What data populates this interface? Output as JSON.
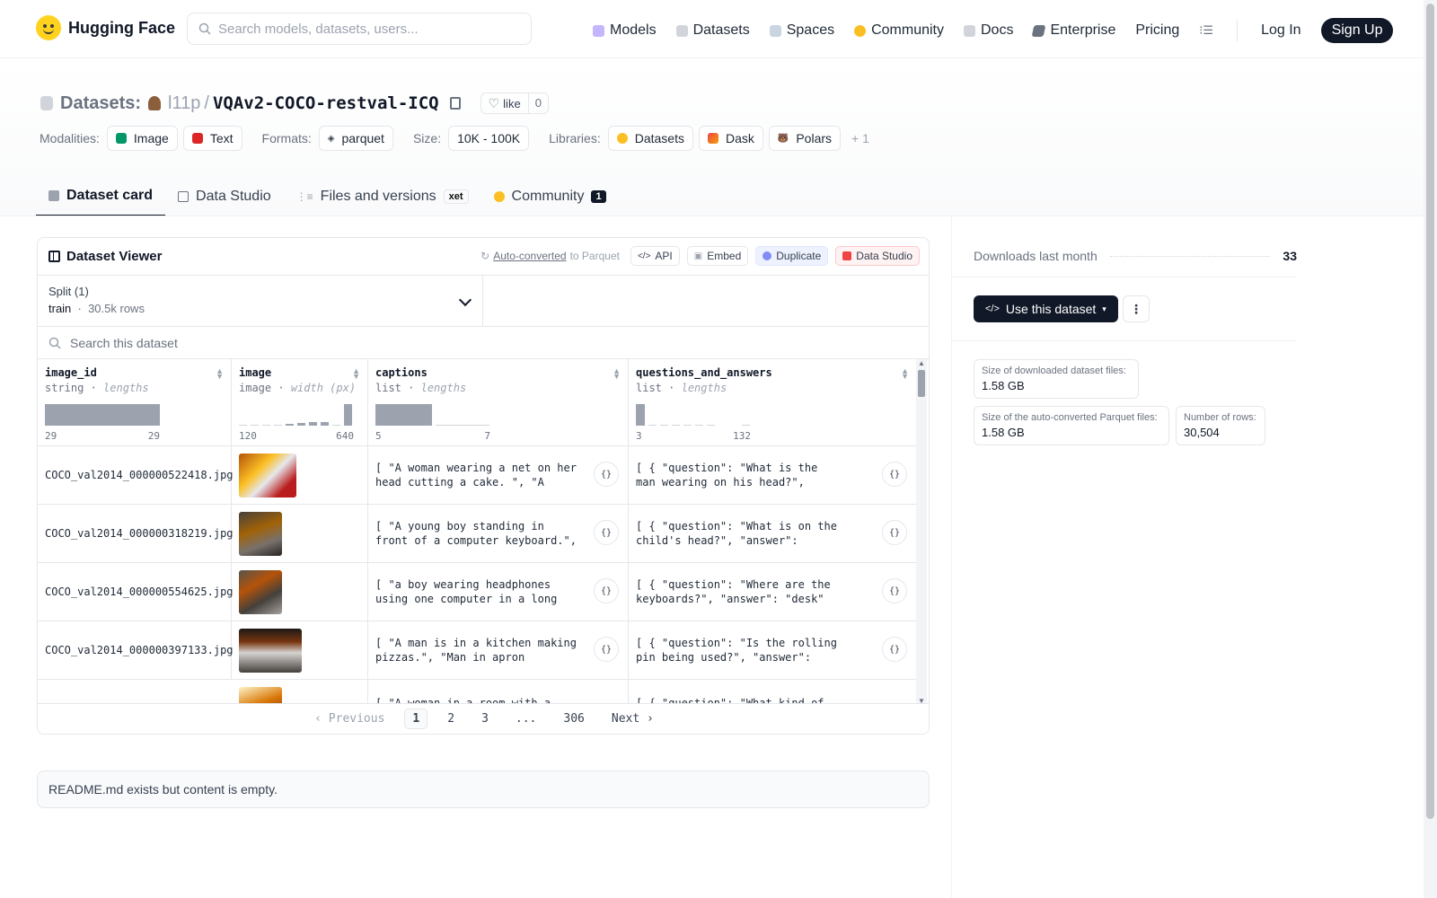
{
  "nav": {
    "brand": "Hugging Face",
    "search_placeholder": "Search models, datasets, users...",
    "items": [
      {
        "label": "Models",
        "icon": "models-icon",
        "color": "#a78bfa"
      },
      {
        "label": "Datasets",
        "icon": "datasets-icon",
        "color": "#d1d5db"
      },
      {
        "label": "Spaces",
        "icon": "spaces-icon",
        "color": "#9ca3af"
      },
      {
        "label": "Community",
        "icon": "community-icon",
        "color": "#fbbf24"
      },
      {
        "label": "Docs",
        "icon": "docs-icon",
        "color": "#d1d5db"
      },
      {
        "label": "Enterprise",
        "icon": "enterprise-icon",
        "color": "#6b7280"
      },
      {
        "label": "Pricing"
      }
    ],
    "login": "Log In",
    "signup": "Sign Up"
  },
  "header": {
    "section": "Datasets:",
    "user": "l11p",
    "separator": "/",
    "repo": "VQAv2-COCO-restval-ICQ",
    "like_label": "like",
    "like_count": "0",
    "modalities_label": "Modalities:",
    "modalities": [
      "Image",
      "Text"
    ],
    "formats_label": "Formats:",
    "format": "parquet",
    "size_label": "Size:",
    "size": "10K - 100K",
    "libraries_label": "Libraries:",
    "libraries": [
      "Datasets",
      "Dask",
      "Polars"
    ],
    "libraries_more": "+ 1"
  },
  "tabs": {
    "dataset_card": "Dataset card",
    "data_studio": "Data Studio",
    "files": "Files and versions",
    "xet": "xet",
    "community": "Community",
    "community_count": "1"
  },
  "viewer": {
    "title": "Dataset Viewer",
    "auto_converted": "Auto-converted",
    "to_parquet": "to Parquet",
    "api": "API",
    "embed": "Embed",
    "duplicate": "Duplicate",
    "data_studio": "Data Studio",
    "split_label": "Split (1)",
    "split_name": "train",
    "split_rows": "30.5k rows",
    "search_placeholder": "Search this dataset",
    "columns": [
      {
        "name": "image_id",
        "type": "string",
        "stat": "lengths",
        "min": "29",
        "max": "29"
      },
      {
        "name": "image",
        "type": "image",
        "stat": "width (px)",
        "min": "120",
        "max": "640"
      },
      {
        "name": "captions",
        "type": "list",
        "stat": "lengths",
        "min": "5",
        "max": "7"
      },
      {
        "name": "questions_and_answers",
        "type": "list",
        "stat": "lengths",
        "min": "3",
        "max": "132"
      }
    ],
    "rows": [
      {
        "image_id": "COCO_val2014_000000522418.jpg",
        "captions": "[ \"A woman wearing a net on her head cutting a cake. \", \"A woman cutting a large white sheet cake.\" ]",
        "qa": "[ { \"question\": \"What is the man wearing on his head?\", \"answer\": \"hat\" } ]"
      },
      {
        "image_id": "COCO_val2014_000000318219.jpg",
        "captions": "[ \"A young boy standing in front of a computer keyboard.\", \"a little boy wearing headphones\" ]",
        "qa": "[ { \"question\": \"What is on the child's head?\", \"answer\": \"headphones\" } ]"
      },
      {
        "image_id": "COCO_val2014_000000554625.jpg",
        "captions": "[ \"a boy wearing headphones using one computer in a long row of computers\" ]",
        "qa": "[ { \"question\": \"Where are the keyboards?\", \"answer\": \"desk\" }, { ... } ]"
      },
      {
        "image_id": "COCO_val2014_000000397133.jpg",
        "captions": "[ \"A man is in a kitchen making pizzas.\", \"Man in apron standing on front of oven\" ]",
        "qa": "[ { \"question\": \"Is the rolling pin being used?\", \"answer\": \"yes\" }, { ... } ]"
      },
      {
        "image_id": "",
        "captions": "[ \"A woman in a room with a cat.\"",
        "qa": "[ { \"question\": \"What kind of shoes"
      }
    ],
    "pager": {
      "prev": "Previous",
      "pages": [
        "1",
        "2",
        "3",
        "...",
        "306"
      ],
      "next": "Next"
    }
  },
  "readme": "README.md exists but content is empty.",
  "sidebar": {
    "downloads_label": "Downloads last month",
    "downloads": "33",
    "use_dataset": "Use this dataset",
    "stats": [
      {
        "label": "Size of downloaded dataset files:",
        "value": "1.58 GB"
      },
      {
        "label": "Size of the auto-converted Parquet files:",
        "value": "1.58 GB"
      },
      {
        "label": "Number of rows:",
        "value": "30,504"
      }
    ]
  }
}
